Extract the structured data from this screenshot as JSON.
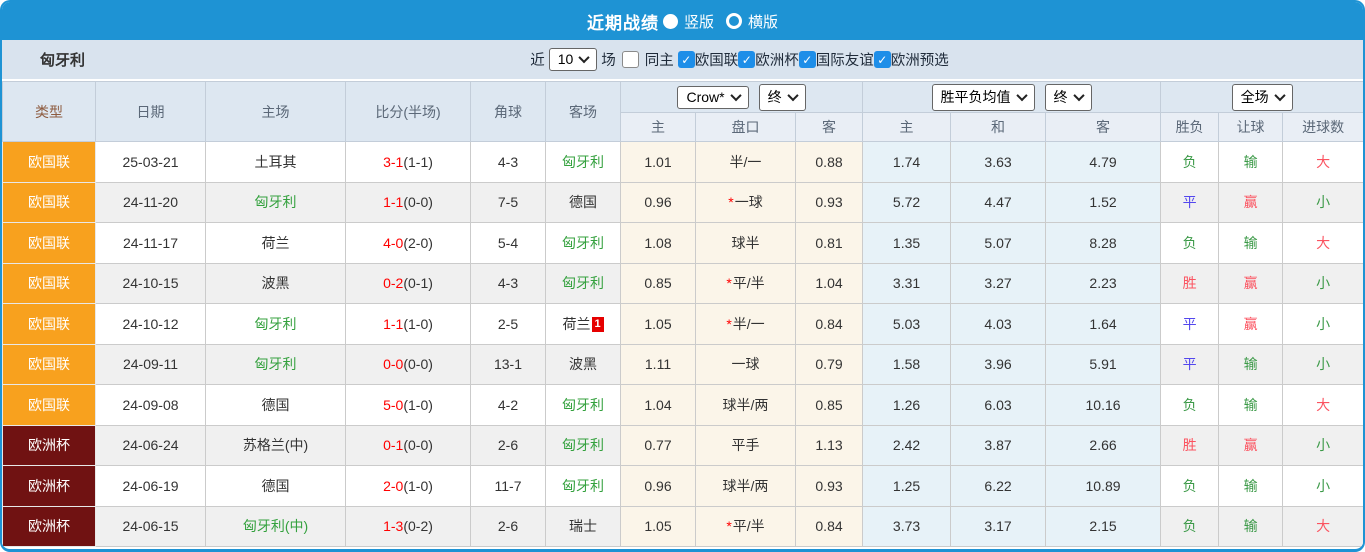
{
  "colors": {
    "bar_blue": "#1E93D4",
    "checkbox_blue": "#1E8EE8",
    "type_nations_orange": "#F8A11E",
    "type_euro_maroon": "#701212",
    "team_green": "#34A13E",
    "score_red": "#FF0000",
    "win_red": "#FB5360",
    "draw_blue": "#5347EE",
    "lose_green": "#3C9A48",
    "odds_cream": "#FBF5E9",
    "avg_lightblue": "#E7F2F8",
    "alt_row_gray": "#F0F0F0",
    "filter_bg": "#D9E3EE",
    "header_bg": "#DDE7F1"
  },
  "icons": {
    "check": "✓"
  },
  "titlebar": {
    "title": "近期战绩",
    "vertical": "竖版",
    "horizontal": "横版"
  },
  "filterbar": {
    "team": "匈牙利",
    "near": "近",
    "count": "10",
    "games": "场",
    "same_home": "同主",
    "leagues": [
      "欧国联",
      "欧洲杯",
      "国际友谊",
      "欧洲预选"
    ]
  },
  "table": {
    "headers": {
      "type": "类型",
      "date": "日期",
      "home": "主场",
      "score": "比分(半场)",
      "corner": "角球",
      "away": "客场",
      "odds_source": "Crow*",
      "odds_time": "终",
      "avg_label": "胜平负均值",
      "avg_time": "终",
      "scope": "全场",
      "sub": [
        "主",
        "盘口",
        "客",
        "主",
        "和",
        "客",
        "胜负",
        "让球",
        "进球数"
      ]
    },
    "rows": [
      {
        "type": "欧国联",
        "style": "nations",
        "date": "25-03-21",
        "home": "土耳其",
        "home_green": false,
        "score": "3-1",
        "half": "(1-1)",
        "corners": "4-3",
        "away": "匈牙利",
        "away_green": true,
        "red_card": "",
        "home_odds": "1.01",
        "star": false,
        "handicap": "半/一",
        "away_odds": "0.88",
        "avg": [
          "1.74",
          "3.63",
          "4.79"
        ],
        "result": "负",
        "result_c": "green",
        "cover": "输",
        "cover_c": "green",
        "ou": "大",
        "ou_c": "red"
      },
      {
        "type": "欧国联",
        "style": "nations",
        "date": "24-11-20",
        "home": "匈牙利",
        "home_green": true,
        "score": "1-1",
        "half": "(0-0)",
        "corners": "7-5",
        "away": "德国",
        "away_green": false,
        "red_card": "",
        "home_odds": "0.96",
        "star": true,
        "handicap": "一球",
        "away_odds": "0.93",
        "avg": [
          "5.72",
          "4.47",
          "1.52"
        ],
        "result": "平",
        "result_c": "blue",
        "cover": "赢",
        "cover_c": "red",
        "ou": "小",
        "ou_c": "green"
      },
      {
        "type": "欧国联",
        "style": "nations",
        "date": "24-11-17",
        "home": "荷兰",
        "home_green": false,
        "score": "4-0",
        "half": "(2-0)",
        "corners": "5-4",
        "away": "匈牙利",
        "away_green": true,
        "red_card": "",
        "home_odds": "1.08",
        "star": false,
        "handicap": "球半",
        "away_odds": "0.81",
        "avg": [
          "1.35",
          "5.07",
          "8.28"
        ],
        "result": "负",
        "result_c": "green",
        "cover": "输",
        "cover_c": "green",
        "ou": "大",
        "ou_c": "red"
      },
      {
        "type": "欧国联",
        "style": "nations",
        "date": "24-10-15",
        "home": "波黑",
        "home_green": false,
        "score": "0-2",
        "half": "(0-1)",
        "corners": "4-3",
        "away": "匈牙利",
        "away_green": true,
        "red_card": "",
        "home_odds": "0.85",
        "star": true,
        "handicap": "平/半",
        "away_odds": "1.04",
        "avg": [
          "3.31",
          "3.27",
          "2.23"
        ],
        "result": "胜",
        "result_c": "red",
        "cover": "赢",
        "cover_c": "red",
        "ou": "小",
        "ou_c": "green"
      },
      {
        "type": "欧国联",
        "style": "nations",
        "date": "24-10-12",
        "home": "匈牙利",
        "home_green": true,
        "score": "1-1",
        "half": "(1-0)",
        "corners": "2-5",
        "away": "荷兰",
        "away_green": false,
        "red_card": "1",
        "home_odds": "1.05",
        "star": true,
        "handicap": "半/一",
        "away_odds": "0.84",
        "avg": [
          "5.03",
          "4.03",
          "1.64"
        ],
        "result": "平",
        "result_c": "blue",
        "cover": "赢",
        "cover_c": "red",
        "ou": "小",
        "ou_c": "green"
      },
      {
        "type": "欧国联",
        "style": "nations",
        "date": "24-09-11",
        "home": "匈牙利",
        "home_green": true,
        "score": "0-0",
        "half": "(0-0)",
        "corners": "13-1",
        "away": "波黑",
        "away_green": false,
        "red_card": "",
        "home_odds": "1.11",
        "star": false,
        "handicap": "一球",
        "away_odds": "0.79",
        "avg": [
          "1.58",
          "3.96",
          "5.91"
        ],
        "result": "平",
        "result_c": "blue",
        "cover": "输",
        "cover_c": "green",
        "ou": "小",
        "ou_c": "green"
      },
      {
        "type": "欧国联",
        "style": "nations",
        "date": "24-09-08",
        "home": "德国",
        "home_green": false,
        "score": "5-0",
        "half": "(1-0)",
        "corners": "4-2",
        "away": "匈牙利",
        "away_green": true,
        "red_card": "",
        "home_odds": "1.04",
        "star": false,
        "handicap": "球半/两",
        "away_odds": "0.85",
        "avg": [
          "1.26",
          "6.03",
          "10.16"
        ],
        "result": "负",
        "result_c": "green",
        "cover": "输",
        "cover_c": "green",
        "ou": "大",
        "ou_c": "red"
      },
      {
        "type": "欧洲杯",
        "style": "euro",
        "date": "24-06-24",
        "home": "苏格兰(中)",
        "home_green": false,
        "score": "0-1",
        "half": "(0-0)",
        "corners": "2-6",
        "away": "匈牙利",
        "away_green": true,
        "red_card": "",
        "home_odds": "0.77",
        "star": false,
        "handicap": "平手",
        "away_odds": "1.13",
        "avg": [
          "2.42",
          "3.87",
          "2.66"
        ],
        "result": "胜",
        "result_c": "red",
        "cover": "赢",
        "cover_c": "red",
        "ou": "小",
        "ou_c": "green"
      },
      {
        "type": "欧洲杯",
        "style": "euro",
        "date": "24-06-19",
        "home": "德国",
        "home_green": false,
        "score": "2-0",
        "half": "(1-0)",
        "corners": "11-7",
        "away": "匈牙利",
        "away_green": true,
        "red_card": "",
        "home_odds": "0.96",
        "star": false,
        "handicap": "球半/两",
        "away_odds": "0.93",
        "avg": [
          "1.25",
          "6.22",
          "10.89"
        ],
        "result": "负",
        "result_c": "green",
        "cover": "输",
        "cover_c": "green",
        "ou": "小",
        "ou_c": "green"
      },
      {
        "type": "欧洲杯",
        "style": "euro",
        "date": "24-06-15",
        "home": "匈牙利(中)",
        "home_green": true,
        "score": "1-3",
        "half": "(0-2)",
        "corners": "2-6",
        "away": "瑞士",
        "away_green": false,
        "red_card": "",
        "home_odds": "1.05",
        "star": true,
        "handicap": "平/半",
        "away_odds": "0.84",
        "avg": [
          "3.73",
          "3.17",
          "2.15"
        ],
        "result": "负",
        "result_c": "green",
        "cover": "输",
        "cover_c": "green",
        "ou": "大",
        "ou_c": "red"
      }
    ]
  }
}
